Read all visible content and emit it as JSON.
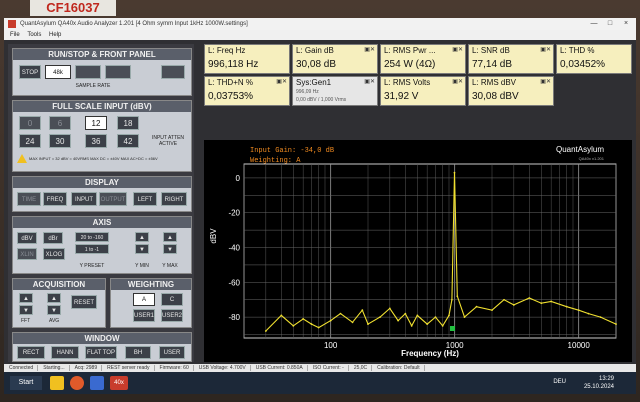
{
  "sticker_text": "CF16037",
  "window": {
    "title": "QuantAsylum QA40x Audio Analyzer 1.201 [4 Ohm symm Input 1kHz 1000W.settings]",
    "controls": [
      "—",
      "□",
      "×"
    ]
  },
  "menu": [
    "File",
    "Tools",
    "Help"
  ],
  "left_panel": {
    "run_stop": {
      "title": "RUN/STOP & FRONT PANEL",
      "stop_label": "STOP",
      "rate_label": "48k",
      "sample_rate_label": "SAMPLE RATE"
    },
    "full_scale": {
      "title": "FULL SCALE INPUT (dBV)",
      "row1": [
        "0",
        "6",
        "12",
        "18"
      ],
      "row2": [
        "24",
        "30",
        "36",
        "42"
      ],
      "selected": "12",
      "atten_label": "INPUT ATTEN ACTIVE",
      "warning": "MAX INPUT = 32 dBV = 40VRMS   MAX DC = ±40V   MAX AC+DC = ±56V"
    },
    "display": {
      "title": "DISPLAY",
      "buttons": [
        "TIME",
        "FREQ",
        "INPUT",
        "OUTPUT",
        "LEFT",
        "RIGHT"
      ],
      "selected": [
        "FREQ",
        "INPUT",
        "LEFT"
      ]
    },
    "axis": {
      "title": "AXIS",
      "dbv_label": "dBV",
      "dbu_label": "dBr",
      "range_label": "20 to -160",
      "preset_label": "1 to -1",
      "xlin_label": "XLIN",
      "xlog_label": "XLOG",
      "y_preset_label": "Y PRESET",
      "y_min_label": "Y MIN",
      "y_max_label": "Y MAX"
    },
    "acquisition": {
      "title": "ACQUISITION",
      "fft_label": "FFT",
      "avg_label": "AVG",
      "reset_label": "RESET"
    },
    "weighting": {
      "title": "WEIGHTING",
      "buttons": [
        "A",
        "C",
        "USER1",
        "USER2"
      ],
      "selected": "A"
    },
    "window_sec": {
      "title": "WINDOW",
      "buttons": [
        "RECT",
        "HANN",
        "FLAT TOP",
        "BH",
        "USER"
      ],
      "selected": "HANN"
    }
  },
  "meters": [
    {
      "label": "L: Freq Hz",
      "value": "996,118 Hz"
    },
    {
      "label": "L: Gain dB",
      "value": "30,08 dB"
    },
    {
      "label": "L: RMS Pwr ...",
      "value": "254 W (4Ω)"
    },
    {
      "label": "L: SNR dB",
      "value": "77,14 dB"
    },
    {
      "label": "L: THD %",
      "value": "0,03452%"
    },
    {
      "label": "L: THD+N %",
      "value": "0,03753%"
    },
    {
      "label": "Sys:Gen1",
      "value": "996,09 Hz",
      "sub": "0,00 dBV / 1,000 Vrms"
    },
    {
      "label": "L: RMS Volts",
      "value": "31,92 V"
    },
    {
      "label": "L: RMS dBV",
      "value": "30,08 dBV"
    }
  ],
  "graph": {
    "annotation_gain": "Input Gain: -34,0 dB",
    "annotation_weighting": "Weighting: A",
    "logo": "QuantAsylum",
    "logo_sub": "QA40x v1.201",
    "ylabel": "dBV",
    "xlabel": "Frequency (Hz)",
    "yticks": [
      "0",
      "-20",
      "-40",
      "-60",
      "-80"
    ],
    "xticks": [
      "100",
      "1000",
      "10000"
    ]
  },
  "chart_data": {
    "type": "line",
    "xlabel": "Frequency (Hz)",
    "ylabel": "dBV",
    "xscale": "log",
    "xlim": [
      20,
      20000
    ],
    "ylim": [
      -92,
      8
    ],
    "series": [
      {
        "color": "#f0e030",
        "x": [
          30,
          40,
          50,
          60,
          70,
          80,
          100,
          120,
          150,
          180,
          200,
          250,
          300,
          350,
          400,
          450,
          500,
          600,
          700,
          800,
          900,
          950,
          996,
          1050,
          1200,
          1500,
          2000,
          2500,
          3000,
          4000,
          5000,
          6000,
          8000,
          10000,
          12000,
          15000,
          20000
        ],
        "y": [
          -88,
          -79,
          -85,
          -81,
          -84,
          -86,
          -82,
          -78,
          -83,
          -76,
          -84,
          -80,
          -75,
          -82,
          -78,
          -85,
          -79,
          -84,
          -80,
          -85,
          -79,
          -70,
          3,
          -68,
          -80,
          -74,
          -76,
          -70,
          -73,
          -69,
          -72,
          -71,
          -74,
          -76,
          -78,
          -80,
          -84
        ]
      }
    ],
    "grid": true
  },
  "status_bar": [
    "Connected",
    "Starting...",
    "Acq: 2989",
    "REST server ready",
    "Firmware: 60",
    "USB Voltage: 4.700V",
    "USB Current: 0.850A",
    "ISO Current: -",
    "25,0C",
    "Calibration: Default"
  ],
  "taskbar": {
    "start_label": "Start",
    "app_label": "40x",
    "tray_lang": "DEU",
    "time": "13:29",
    "date": "25.10.2024"
  },
  "colors": {
    "accent_yellow": "#f0e030",
    "meter_bg": "#f6efbe",
    "graph_bg": "#000000",
    "annotation": "#f08a20"
  }
}
